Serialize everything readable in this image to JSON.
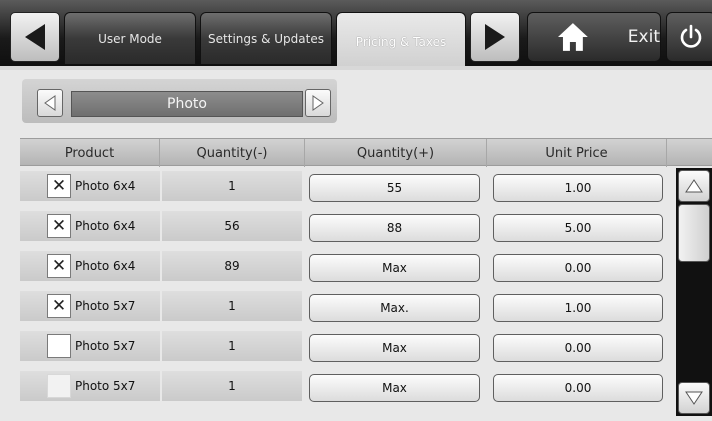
{
  "tabs": [
    {
      "label": "User Mode"
    },
    {
      "label": "Settings & Updates"
    },
    {
      "label": "Pricing & Taxes"
    }
  ],
  "exit_label": "Exit",
  "category": {
    "value": "Photo"
  },
  "columns": [
    "Product",
    "Quantity(-)",
    "Quantity(+)",
    "Unit Price"
  ],
  "rows": [
    {
      "checked": "✕",
      "product": "Photo 6x4",
      "qty_min": "1",
      "qty_max": "55",
      "unit_price": "1.00"
    },
    {
      "checked": "✕",
      "product": "Photo 6x4",
      "qty_min": "56",
      "qty_max": "88",
      "unit_price": "5.00"
    },
    {
      "checked": "✕",
      "product": "Photo 6x4",
      "qty_min": "89",
      "qty_max": "Max",
      "unit_price": "0.00"
    },
    {
      "checked": "✕",
      "product": "Photo 5x7",
      "qty_min": "1",
      "qty_max": "Max.",
      "unit_price": "1.00"
    },
    {
      "checked": "",
      "product": "Photo 5x7",
      "qty_min": "1",
      "qty_max": "Max",
      "unit_price": "0.00"
    },
    {
      "checked": "",
      "product": "Photo 5x7",
      "qty_min": "1",
      "qty_max": "Max",
      "unit_price": "0.00"
    }
  ],
  "icons": {
    "nav_back": "left-arrow-icon",
    "nav_forward": "right-arrow-icon",
    "home": "home-icon",
    "power": "power-icon",
    "category_prev": "left-arrow-icon",
    "category_next": "right-arrow-icon",
    "scroll_up": "up-arrow-icon",
    "scroll_down": "down-arrow-icon"
  }
}
